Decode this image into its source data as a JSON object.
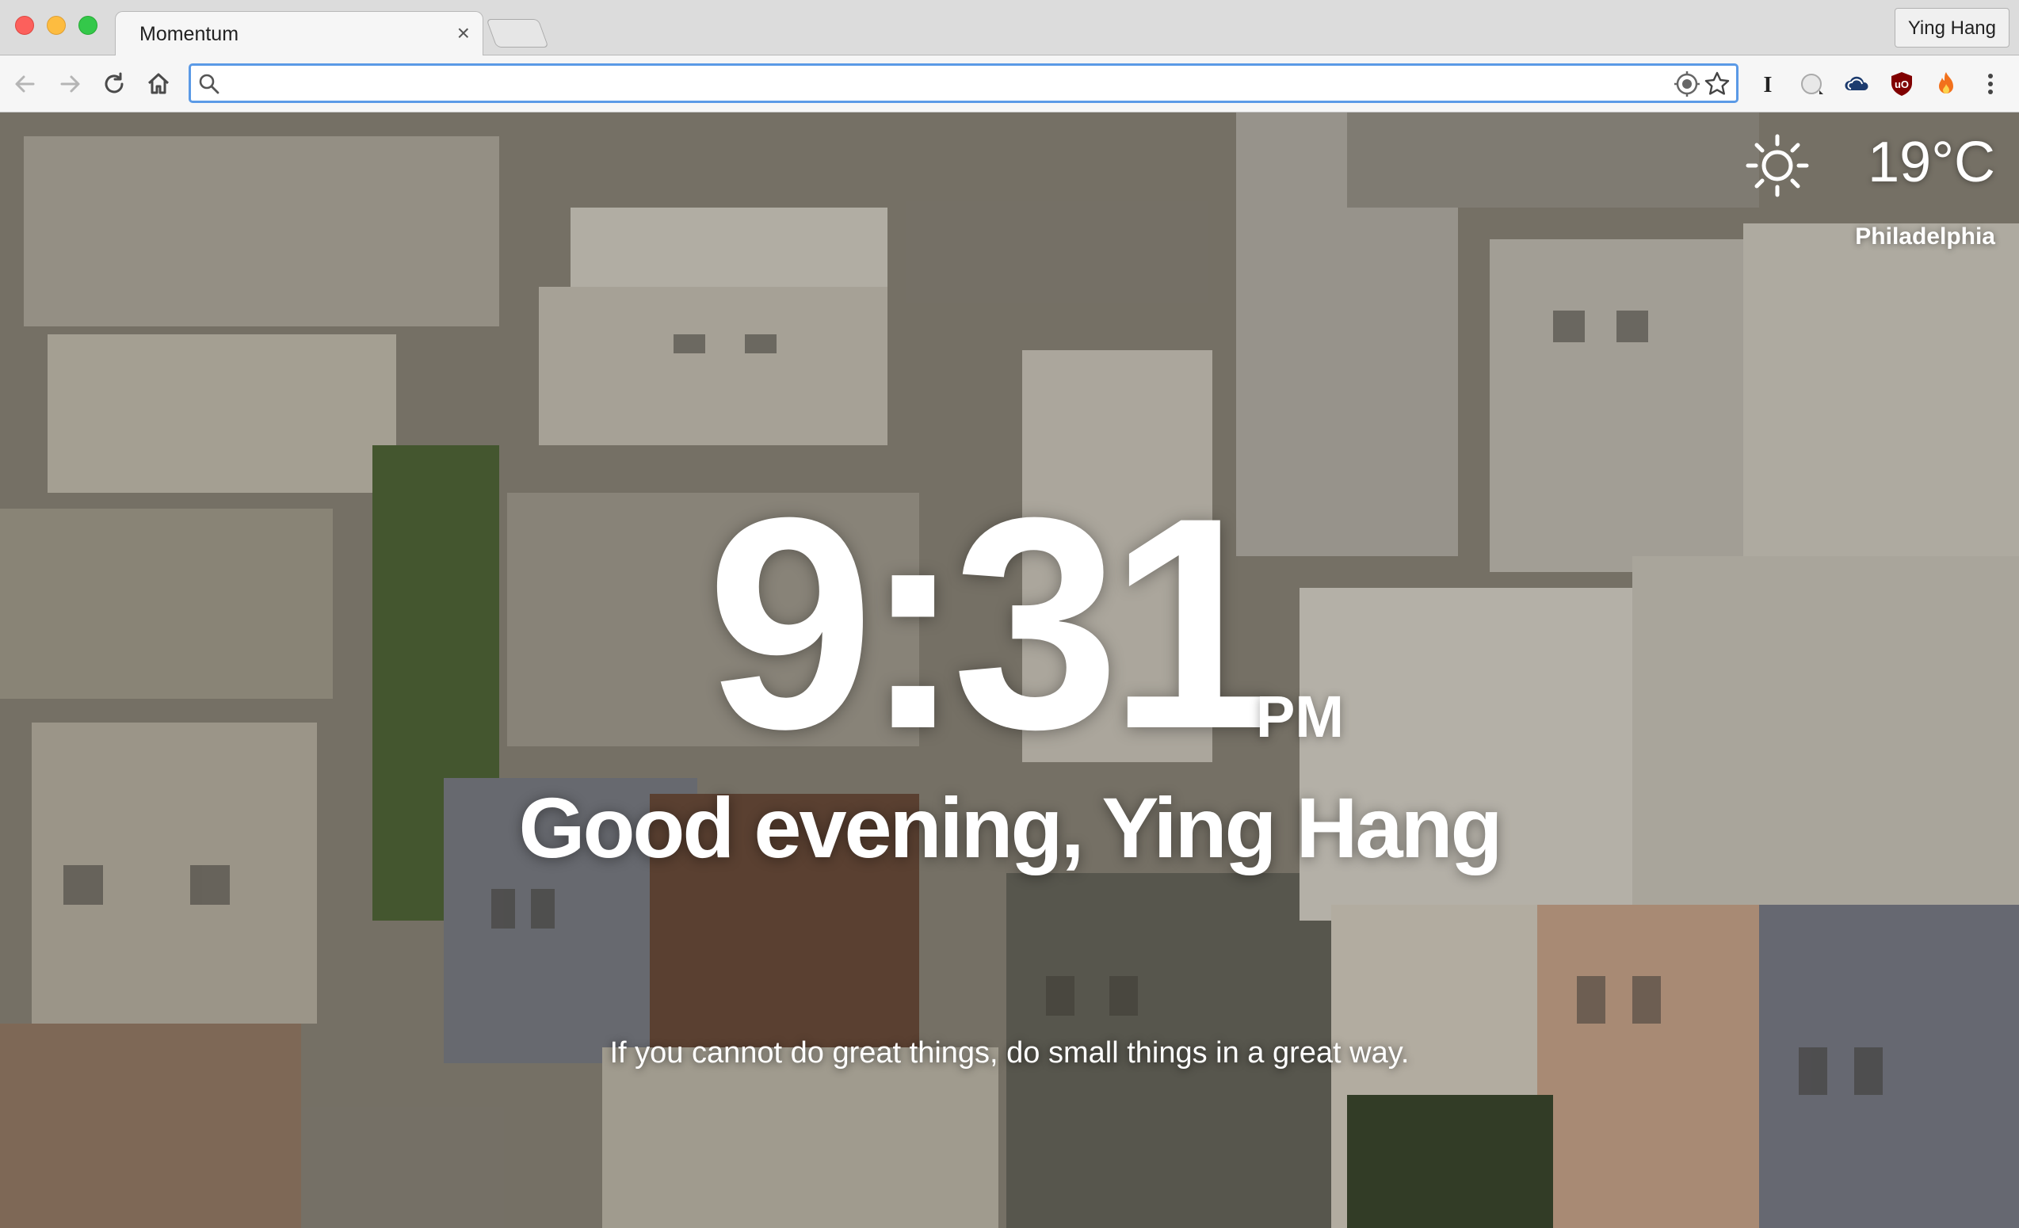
{
  "browser": {
    "tab_title": "Momentum",
    "tab_close": "×",
    "profile_name": "Ying Hang",
    "omnibox_value": "",
    "omnibox_placeholder": "",
    "extensions": [
      "instapaper-icon",
      "blank-ext-icon",
      "cloud-ext-icon",
      "ublock-origin-icon",
      "fire-ext-icon"
    ],
    "accent": "#5b9ae6"
  },
  "weather": {
    "icon": "sun-icon",
    "temperature": "19°C",
    "location": "Philadelphia"
  },
  "clock": {
    "time": "9:31",
    "ampm": "PM"
  },
  "greeting": "Good evening, Ying Hang",
  "quote": "If you cannot do great things, do small things in a great way."
}
